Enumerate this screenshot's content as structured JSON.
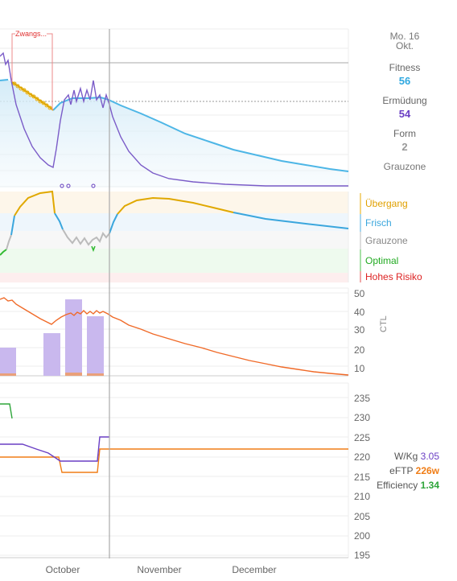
{
  "annotation": {
    "forced_label": "Zwangs..."
  },
  "info": {
    "date_line1": "Mo. 16",
    "date_line2": "Okt.",
    "fitness_label": "Fitness",
    "fitness_value": "56",
    "fatigue_label": "Ermüdung",
    "fatigue_value": "54",
    "form_label": "Form",
    "form_value": "2",
    "zone_label": "Grauzone"
  },
  "zones": [
    {
      "label": "Übergang",
      "color": "#e0a000"
    },
    {
      "label": "Frisch",
      "color": "#3aa6dd"
    },
    {
      "label": "Grauzone",
      "color": "#888888"
    },
    {
      "label": "Optimal",
      "color": "#22aa22"
    },
    {
      "label": "Hohes Risiko",
      "color": "#dd2222"
    }
  ],
  "ctl_axis": {
    "label": "CTL",
    "ticks": [
      "50",
      "40",
      "30",
      "20",
      "10"
    ]
  },
  "power_axis": {
    "ticks": [
      "235",
      "230",
      "225",
      "220",
      "215",
      "210",
      "205",
      "200",
      "195"
    ]
  },
  "metrics": {
    "wkg_label": "W/Kg",
    "wkg_value": "3.05",
    "eftp_label": "eFTP",
    "eftp_value": "226w",
    "eff_label": "Efficiency",
    "eff_value": "1.34"
  },
  "months": [
    "October",
    "November",
    "December"
  ],
  "colors": {
    "fitness": "#4db6e6",
    "fatigue": "#7b5cc8",
    "transition": "#e0a800",
    "fresh": "#3aa6dd",
    "grey": "#aaaaaa",
    "optimal": "#33bb33",
    "risk": "#dd2222",
    "ctl": "#f06a28",
    "load_bar": "#c9b8ee",
    "wkg": "#6a3fc4",
    "eftp": "#f07d16",
    "efficiency": "#2ea53a"
  }
}
